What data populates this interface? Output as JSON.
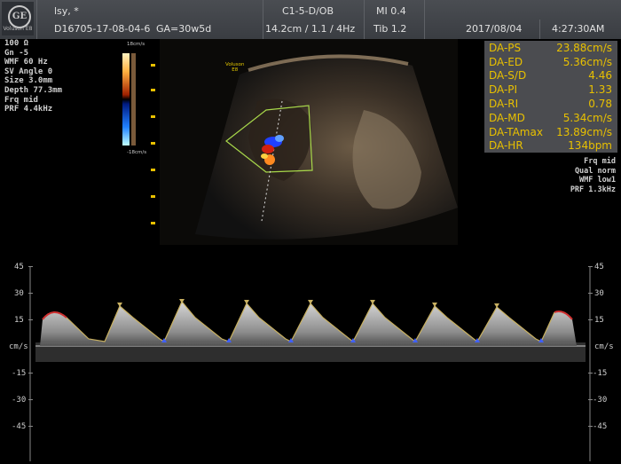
{
  "header": {
    "logo_text": "GE",
    "logo_subtitle": "Voluson E8",
    "patient_name": "lsy, *",
    "patient_id": "D16705-17-08-04-6",
    "gestational_age": "GA=30w5d",
    "probe": "C1-5-D/OB",
    "mi": "MI 0.4",
    "scan_params": "14.2cm / 1.1 / 4Hz",
    "tib": "Tib 1.2",
    "date": "2017/08/04",
    "time": "4:27:30AM"
  },
  "left_params": [
    "100 Ω",
    "Gn -5",
    "WMF 60 Hz",
    "SV Angle 0",
    "Size 3.0mm",
    "Depth 77.3mm",
    "Frq mid",
    "PRF 4.4kHz"
  ],
  "color_bar": {
    "top": "18cm/s",
    "bottom": "-18cm/s"
  },
  "probe_label": {
    "line1": "Voluson",
    "line2": "E8"
  },
  "measurements": [
    {
      "label": "DA-PS",
      "value": "23.88cm/s"
    },
    {
      "label": "DA-ED",
      "value": "5.36cm/s"
    },
    {
      "label": "DA-S/D",
      "value": "4.46"
    },
    {
      "label": "DA-PI",
      "value": "1.33"
    },
    {
      "label": "DA-RI",
      "value": "0.78"
    },
    {
      "label": "DA-MD",
      "value": "5.34cm/s"
    },
    {
      "label": "DA-TAmax",
      "value": "13.89cm/s"
    },
    {
      "label": "DA-HR",
      "value": "134bpm"
    }
  ],
  "right_params": [
    "Frq mid",
    "Qual norm",
    "WMF low1",
    "PRF 1.3kHz"
  ],
  "doppler": {
    "unit": "cm/s",
    "ticks": [
      "45",
      "30",
      "15",
      "-15",
      "-30",
      "-45"
    ]
  },
  "colors": {
    "measure_text": "#e8c000",
    "header_bg": "#3f4247",
    "measure_bg": "#4b4c50",
    "roi_box": "#a8d84a"
  }
}
